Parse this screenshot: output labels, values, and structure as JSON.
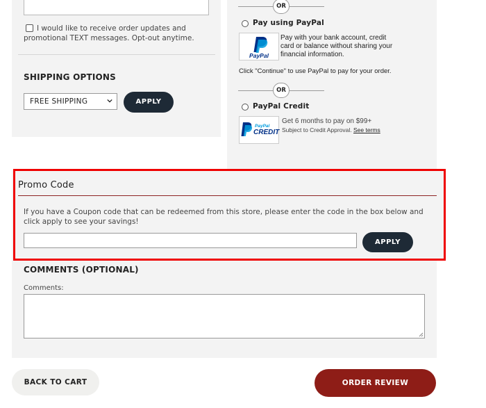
{
  "left": {
    "sms_optin_label": "I would like to receive order updates and promotional TEXT messages. Opt-out anytime.",
    "shipping_title": "SHIPPING OPTIONS",
    "shipping_selected": "FREE SHIPPING",
    "shipping_apply_label": "APPLY"
  },
  "payment": {
    "or_label": "OR",
    "paypal": {
      "label": "Pay using PayPal",
      "logo_text": "PayPal",
      "description": "Pay with your bank account, credit card or balance without sharing your financial information.",
      "continue_note": "Click \"Continue\" to use PayPal to pay for your order."
    },
    "paypal_credit": {
      "label": "PayPal Credit",
      "logo_text_top": "PayPal",
      "logo_text_bottom": "CREDIT",
      "line1": "Get 6 months to pay on $99+",
      "line2": "Subject to Credit Approval.",
      "see_terms": "See terms"
    }
  },
  "promo": {
    "title": "Promo Code",
    "description": "If you have a Coupon code that can be redeemed from this store, please enter the code in the box below and click apply to see your savings!",
    "input_value": "",
    "apply_label": "APPLY"
  },
  "comments": {
    "title": "COMMENTS (OPTIONAL)",
    "label": "Comments:",
    "value": ""
  },
  "footer": {
    "back_label": "BACK TO CART",
    "order_review_label": "ORDER REVIEW"
  },
  "colors": {
    "dark_button": "#1e2a36",
    "order_button": "#8e1d17",
    "highlight_border": "#ef0000",
    "paypal_blue": "#003087",
    "paypal_light_blue": "#009cde"
  }
}
